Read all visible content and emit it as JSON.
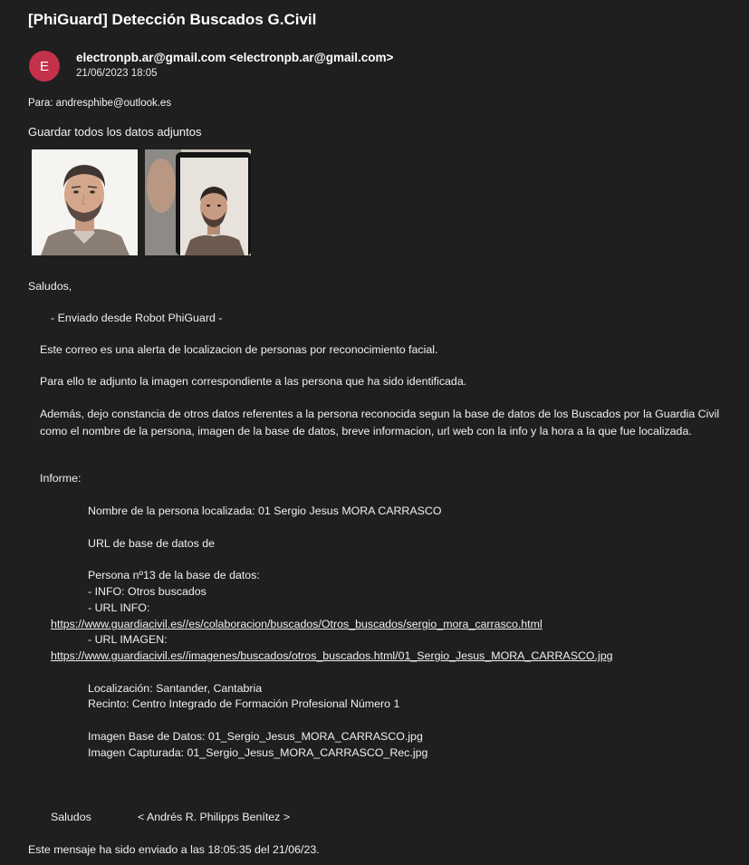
{
  "email": {
    "subject": "[PhiGuard] Detección Buscados G.Civil",
    "avatar_letter": "E",
    "avatar_color": "#c4314b",
    "sender": "electronpb.ar@gmail.com <electronpb.ar@gmail.com>",
    "date": "21/06/2023 18:05",
    "to": "Para: andresphibe@outlook.es",
    "save_all": "Guardar todos los datos adjuntos"
  },
  "attachments": [
    {
      "icon": "person-photo-database"
    },
    {
      "icon": "person-photo-captured"
    }
  ],
  "body": {
    "greeting": "Saludos,",
    "sent_from": "- Enviado desde Robot PhiGuard -",
    "p1": "Este correo es una alerta de localizacion de personas por reconocimiento facial.",
    "p2": "Para ello te adjunto la imagen correspondiente a las persona que ha sido identificada.",
    "p3_line1": "Además, dejo constancia de otros datos referentes a la persona reconocida segun la base de datos de los Buscados por la Guardia Civil",
    "p3_line2": "como el nombre de la persona, imagen de la base de datos, breve informacion, url web con la info y la hora a la que fue localizada.",
    "informe_label": "Informe:",
    "nombre": "Nombre de la persona localizada:   01 Sergio Jesus MORA CARRASCO",
    "url_base": "URL de base de datos de",
    "persona": "Persona nº13 de la base de datos:",
    "info": "- INFO: Otros buscados",
    "url_info_label": "- URL INFO:",
    "url_info": "https://www.guardiacivil.es//es/colaboracion/buscados/Otros_buscados/sergio_mora_carrasco.html",
    "url_imagen_label": "- URL IMAGEN:",
    "url_imagen": "https://www.guardiacivil.es//imagenes/buscados/otros_buscados.html/01_Sergio_Jesus_MORA_CARRASCO.jpg",
    "localizacion": "Localización:      Santander, Cantabria",
    "recinto": "Recinto:    Centro Integrado de Formación Profesional Número 1",
    "imagen_base": "Imagen Base de Datos:      01_Sergio_Jesus_MORA_CARRASCO.jpg",
    "imagen_capturada": "Imagen Capturada:   01_Sergio_Jesus_MORA_CARRASCO_Rec.jpg",
    "sign_saludos": "Saludos",
    "sign_name": "< Andrés R. Philipps Benítez >",
    "footer": "Este mensaje ha sido enviado a las 18:05:35 del 21/06/23."
  }
}
